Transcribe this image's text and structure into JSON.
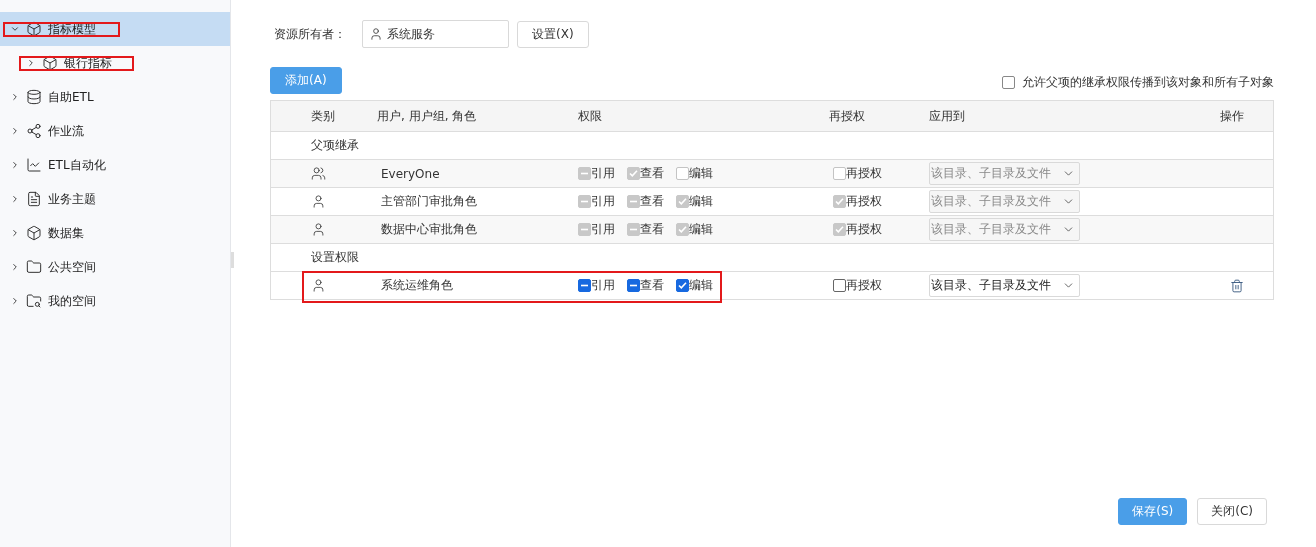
{
  "sidebar": {
    "items": [
      {
        "label": "指标模型",
        "expanded": true,
        "selected": true,
        "highlighted": true,
        "children": [
          {
            "label": "银行指标",
            "expanded": false,
            "selected": false,
            "highlighted": true
          }
        ]
      },
      {
        "label": "自助ETL",
        "expanded": false,
        "selected": false,
        "highlighted": false
      },
      {
        "label": "作业流",
        "expanded": false,
        "selected": false,
        "highlighted": false
      },
      {
        "label": "ETL自动化",
        "expanded": false,
        "selected": false,
        "highlighted": false
      },
      {
        "label": "业务主题",
        "expanded": false,
        "selected": false,
        "highlighted": false
      },
      {
        "label": "数据集",
        "expanded": false,
        "selected": false,
        "highlighted": false
      },
      {
        "label": "公共空间",
        "expanded": false,
        "selected": false,
        "highlighted": false
      },
      {
        "label": "我的空间",
        "expanded": false,
        "selected": false,
        "highlighted": false
      }
    ]
  },
  "owner": {
    "label": "资源所有者：",
    "value": "系统服务",
    "button": "设置(X)"
  },
  "add_button": "添加(A)",
  "propagate": {
    "label": "允许父项的继承权限传播到该对象和所有子对象",
    "checked": false
  },
  "table": {
    "columns": [
      "类别",
      "用户, 用户组, 角色",
      "权限",
      "再授权",
      "应用到",
      "操作"
    ],
    "rows": [
      {
        "kind": "section",
        "label": "父项继承"
      },
      {
        "kind": "group",
        "name": "EveryOne",
        "disabled": true,
        "highlighted": false,
        "deletable": false,
        "permissions": [
          {
            "label": "引用",
            "checked": false,
            "partial": true
          },
          {
            "label": "查看",
            "checked": true,
            "partial": false
          },
          {
            "label": "编辑",
            "checked": false,
            "partial": false
          }
        ],
        "reauth": {
          "label": "再授权",
          "checked": false
        },
        "apply_to": "该目录、子目录及文件"
      },
      {
        "kind": "user",
        "name": "主管部门审批角色",
        "disabled": true,
        "highlighted": false,
        "deletable": false,
        "permissions": [
          {
            "label": "引用",
            "checked": false,
            "partial": true
          },
          {
            "label": "查看",
            "checked": false,
            "partial": true
          },
          {
            "label": "编辑",
            "checked": true,
            "partial": false
          }
        ],
        "reauth": {
          "label": "再授权",
          "checked": true
        },
        "apply_to": "该目录、子目录及文件"
      },
      {
        "kind": "user",
        "name": "数据中心审批角色",
        "disabled": true,
        "highlighted": false,
        "deletable": false,
        "permissions": [
          {
            "label": "引用",
            "checked": false,
            "partial": true
          },
          {
            "label": "查看",
            "checked": false,
            "partial": true
          },
          {
            "label": "编辑",
            "checked": true,
            "partial": false
          }
        ],
        "reauth": {
          "label": "再授权",
          "checked": true
        },
        "apply_to": "该目录、子目录及文件"
      },
      {
        "kind": "section",
        "label": "设置权限"
      },
      {
        "kind": "user",
        "name": "系统运维角色",
        "disabled": false,
        "highlighted": true,
        "deletable": true,
        "permissions": [
          {
            "label": "引用",
            "checked": false,
            "partial": true
          },
          {
            "label": "查看",
            "checked": false,
            "partial": true
          },
          {
            "label": "编辑",
            "checked": true,
            "partial": false
          }
        ],
        "reauth": {
          "label": "再授权",
          "checked": false
        },
        "apply_to": "该目录、子目录及文件"
      }
    ]
  },
  "footer": {
    "buttons": [
      {
        "label": "保存(S)",
        "primary": true
      },
      {
        "label": "关闭(C)",
        "primary": false
      }
    ]
  }
}
